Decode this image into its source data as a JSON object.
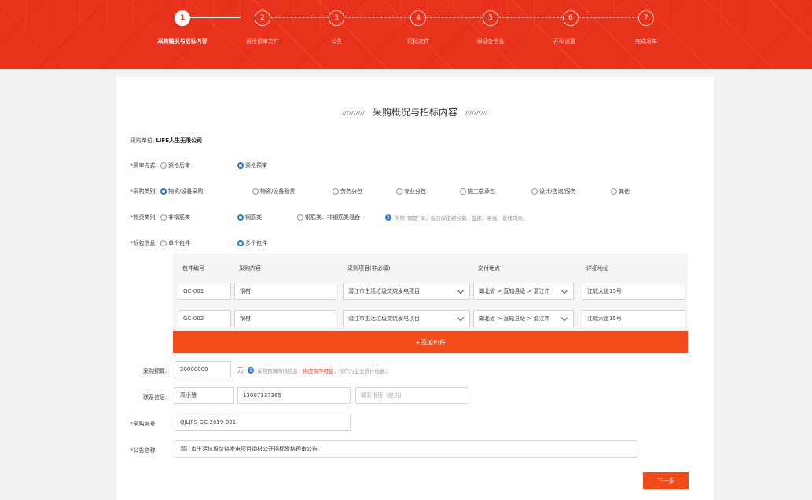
{
  "steps": [
    {
      "num": "1",
      "label": "采购概况与招标内容"
    },
    {
      "num": "2",
      "label": "资格预审文件"
    },
    {
      "num": "3",
      "label": "公告"
    },
    {
      "num": "4",
      "label": "招标文件"
    },
    {
      "num": "5",
      "label": "保证金信息"
    },
    {
      "num": "6",
      "label": "开标设置"
    },
    {
      "num": "7",
      "label": "完成发布"
    }
  ],
  "page": {
    "title": "采购概况与招标内容",
    "title_deco": "//////////"
  },
  "form": {
    "unit_label": "采购单位:",
    "unit_value": "LIFE人生无限公司",
    "review_label": "资审方式:",
    "review_options": [
      "资格后审",
      "资格预审"
    ],
    "category_label": "采购类别:",
    "category_options": [
      "物资/设备采购",
      "物资/设备租赁",
      "劳务分包",
      "专业分包",
      "施工总承包",
      "设计/咨询/服务",
      "其他"
    ],
    "material_label": "物资类别:",
    "material_options": [
      "非钢筋类",
      "钢筋类",
      "钢筋类、非钢筋类混合"
    ],
    "material_hint": "所称“钢筋”类，指且仅指螺纹钢、盘螺、高线、普线四类。",
    "package_label": "标包信息:",
    "package_options": [
      "单个包件",
      "多个包件"
    ],
    "package_headers": [
      "包件编号",
      "采购内容",
      "采购项目(非必填)",
      "交付地点",
      "详细地址"
    ],
    "packages": [
      {
        "code": "GC-001",
        "content": "钢材",
        "project": "潜江市生活垃圾焚烧发电项目",
        "location": "湖北省 > 直辖县级 > 潜江市",
        "address": "江城大道15号"
      },
      {
        "code": "GC-002",
        "content": "钢材",
        "project": "潜江市生活垃圾焚烧发电项目",
        "location": "湖北省 > 直辖县级 > 潜江市",
        "address": "江城大道15号"
      }
    ],
    "add_package": "+添加包件",
    "budget_label": "采购预算:",
    "budget_value": "20000000",
    "budget_unit": "元",
    "budget_hint_a": "采购预算所填信息，",
    "budget_hint_warn": "供应商不可见",
    "budget_hint_b": "，仅作为企业统计依据。",
    "contact_label": "联系信息:",
    "contact_name": "高小慧",
    "contact_phone": "13007137365",
    "contact_tel_placeholder": "联系电话（座机）",
    "purchase_no_label": "采购编号:",
    "purchase_no_value": "QJLJFS-GC-2019-001",
    "notice_name_label": "公告名称:",
    "notice_name_value": "潜江市生活垃圾焚烧发电项目钢材公开招标资格预审公告",
    "next_button": "下一步"
  },
  "colors": {
    "brand": "#e8321b",
    "button": "#f14b1a",
    "radio_selected": "#1f7ae0"
  }
}
